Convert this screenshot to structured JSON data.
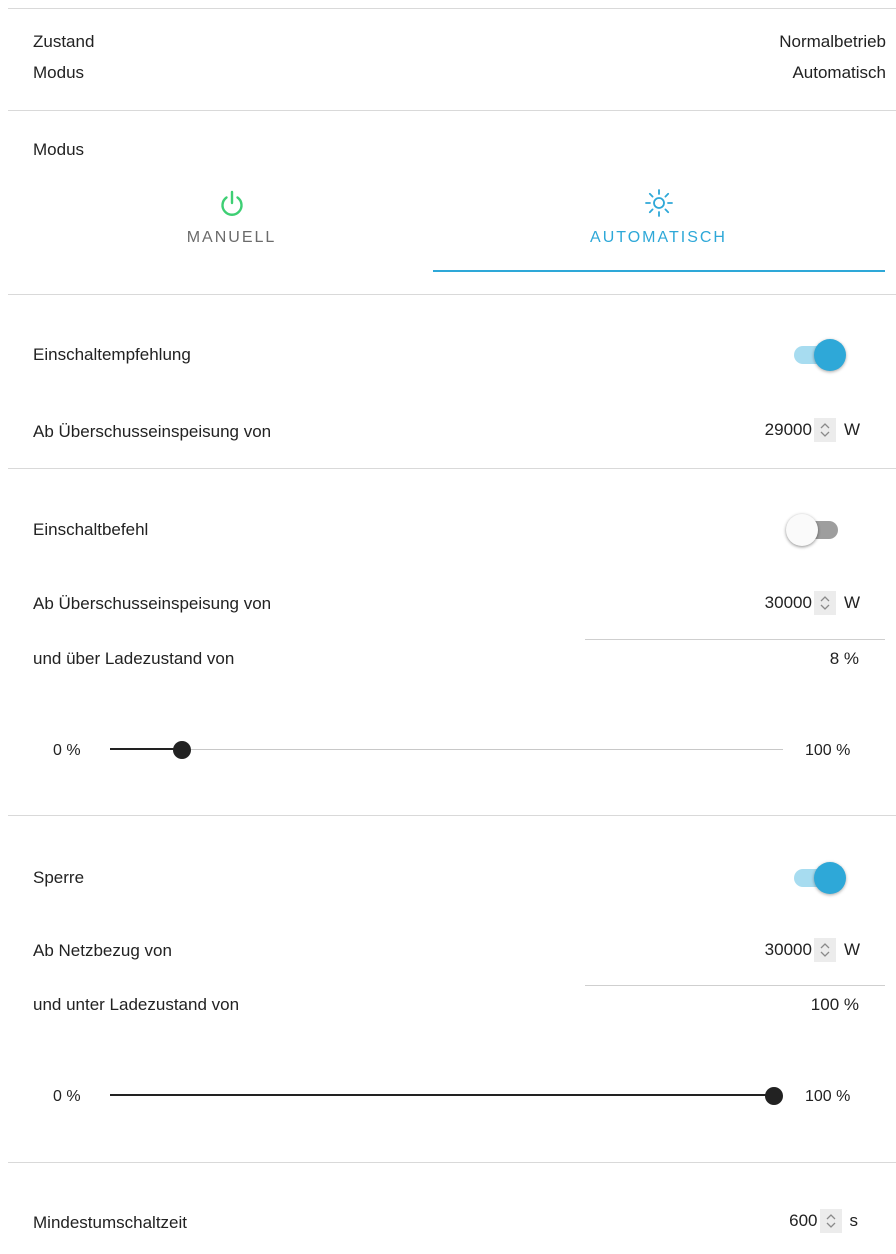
{
  "status": {
    "zustand_label": "Zustand",
    "zustand_value": "Normalbetrieb",
    "modus_label": "Modus",
    "modus_value": "Automatisch"
  },
  "mode_section": {
    "title": "Modus",
    "tabs": [
      {
        "label": "MANUELL",
        "icon": "power-icon",
        "selected": false
      },
      {
        "label": "AUTOMATISCH",
        "icon": "sun-icon",
        "selected": true
      }
    ]
  },
  "recommendation": {
    "label": "Einschaltempfehlung",
    "enabled": true,
    "threshold_label": "Ab Überschusseinspeisung von",
    "threshold_value": "29000",
    "threshold_unit": "W"
  },
  "command": {
    "label": "Einschaltbefehl",
    "enabled": false,
    "threshold_label": "Ab Überschusseinspeisung von",
    "threshold_value": "30000",
    "threshold_unit": "W",
    "soc_label": "und über Ladezustand von",
    "soc_value_text": "8 %",
    "soc_value": 8,
    "slider_min_label": "0 %",
    "slider_max_label": "100 %"
  },
  "block": {
    "label": "Sperre",
    "enabled": true,
    "threshold_label": "Ab Netzbezug von",
    "threshold_value": "30000",
    "threshold_unit": "W",
    "soc_label": "und unter Ladezustand von",
    "soc_value_text": "100 %",
    "soc_value": 100,
    "slider_min_label": "0 %",
    "slider_max_label": "100 %"
  },
  "min_switch": {
    "label": "Mindestumschaltzeit",
    "value": "600",
    "unit": "s"
  },
  "colors": {
    "accent": "#2ea8d8",
    "power_icon": "#3ecf74"
  }
}
